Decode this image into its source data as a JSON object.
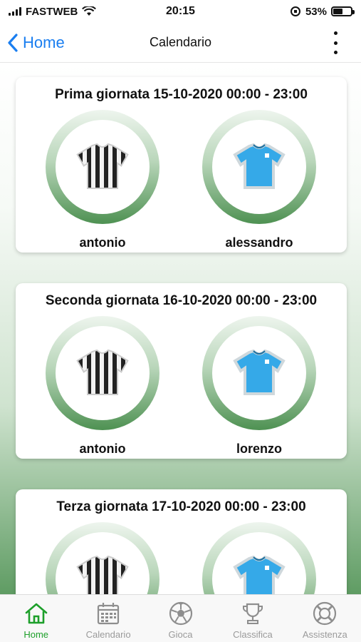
{
  "status_bar": {
    "carrier": "FASTWEB",
    "time": "20:15",
    "battery": "53%",
    "battery_level": 0.53
  },
  "navbar": {
    "back_label": "Home",
    "title": "Calendario"
  },
  "matches": [
    {
      "title": "Prima giornata 15-10-2020 00:00 - 23:00",
      "home": {
        "name": "antonio",
        "shirt": "striped-shirt-icon"
      },
      "away": {
        "name": "alessandro",
        "shirt": "blue-shirt-icon"
      }
    },
    {
      "title": "Seconda giornata 16-10-2020 00:00 - 23:00",
      "home": {
        "name": "antonio",
        "shirt": "striped-shirt-icon"
      },
      "away": {
        "name": "lorenzo",
        "shirt": "blue-shirt-icon"
      }
    },
    {
      "title": "Terza giornata 17-10-2020 00:00 - 23:00",
      "home": {
        "name": "",
        "shirt": "striped-shirt-icon"
      },
      "away": {
        "name": "",
        "shirt": "blue-shirt-icon"
      }
    }
  ],
  "tabbar": {
    "items": [
      {
        "label": "Home",
        "icon": "home-icon",
        "active": true
      },
      {
        "label": "Calendario",
        "icon": "calendar-icon",
        "active": false
      },
      {
        "label": "Gioca",
        "icon": "soccer-ball-icon",
        "active": false
      },
      {
        "label": "Classifica",
        "icon": "trophy-icon",
        "active": false
      },
      {
        "label": "Assistenza",
        "icon": "lifebuoy-icon",
        "active": false
      }
    ]
  },
  "colors": {
    "accent_blue": "#1a7ef0",
    "active_green": "#1d9f2a",
    "inactive_gray": "#9a9a9a",
    "ring_green": "#4e9152",
    "shirt_blue": "#35a9e8"
  }
}
